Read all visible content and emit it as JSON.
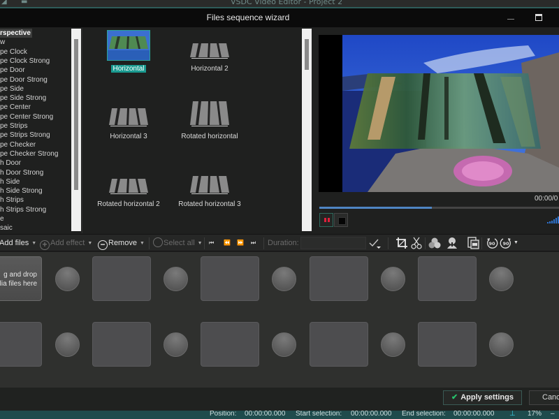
{
  "app": {
    "title": "VSDC Video Editor - Project 2"
  },
  "dialog": {
    "title": "Files sequence wizard"
  },
  "effect_categories": [
    {
      "label": "rspective",
      "selected": true
    },
    {
      "label": "w"
    },
    {
      "label": "pe Clock"
    },
    {
      "label": "pe Clock Strong"
    },
    {
      "label": "pe Door"
    },
    {
      "label": "pe Door Strong"
    },
    {
      "label": "pe Side"
    },
    {
      "label": "pe Side Strong"
    },
    {
      "label": "pe Center"
    },
    {
      "label": "pe Center Strong"
    },
    {
      "label": "pe Strips"
    },
    {
      "label": "pe Strips Strong"
    },
    {
      "label": "pe Checker"
    },
    {
      "label": "pe Checker Strong"
    },
    {
      "label": "h Door"
    },
    {
      "label": "h Door Strong"
    },
    {
      "label": "h Side"
    },
    {
      "label": "h Side Strong"
    },
    {
      "label": "h Strips"
    },
    {
      "label": "h Strips Strong"
    },
    {
      "label": "e"
    },
    {
      "label": "saic"
    }
  ],
  "effects": [
    {
      "label": "Horizontal",
      "selected": true
    },
    {
      "label": "Horizontal 2"
    },
    {
      "label": "Horizontal 3"
    },
    {
      "label": "Rotated horizontal"
    },
    {
      "label": "Rotated horizontal 2"
    },
    {
      "label": "Rotated horizontal 3"
    }
  ],
  "preview": {
    "time": "00:00/0",
    "progress": 0.47
  },
  "toolbar": {
    "add_files": "Add files",
    "add_effect": "Add effect",
    "remove": "Remove",
    "select_all": "Select all",
    "duration_label": "Duration:",
    "duration_value": "",
    "nav_first": "⏮",
    "nav_prev": "⏪",
    "nav_next": "⏩",
    "nav_last": "⏭",
    "rotate_ccw": "90",
    "rotate_cw": "90"
  },
  "storyboard": {
    "drop_text_line1": "g and drop",
    "drop_text_line2": "lia files here"
  },
  "footer": {
    "apply": "Apply settings",
    "cancel": "Cance"
  },
  "status": {
    "position_label": "Position:",
    "position_value": "00:00:00.000",
    "start_label": "Start selection:",
    "start_value": "00:00:00.000",
    "end_label": "End selection:",
    "end_value": "00:00:00.000",
    "zoom": "17%"
  }
}
